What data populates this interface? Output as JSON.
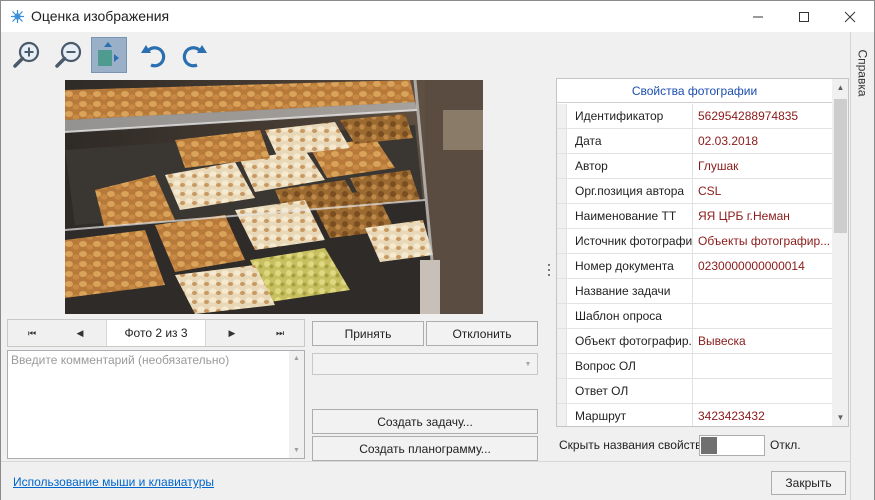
{
  "window": {
    "title": "Оценка изображения",
    "side_tab": "Справка"
  },
  "toolbar": {
    "icons": [
      "zoom-in-icon",
      "zoom-out-icon",
      "fit-image-icon",
      "rotate-left-icon",
      "rotate-right-icon"
    ],
    "active": "fit-image-icon"
  },
  "navigator": {
    "label": "Фото 2 из 3"
  },
  "comment": {
    "placeholder": "Введите комментарий (необязательно)"
  },
  "actions": {
    "accept": "Принять",
    "reject": "Отклонить",
    "create_task": "Создать задачу...",
    "create_planogram": "Создать планограмму..."
  },
  "properties": {
    "header": "Свойства фотографии",
    "rows": [
      {
        "key": "Идентификатор",
        "value": "562954288974835"
      },
      {
        "key": "Дата",
        "value": "02.03.2018"
      },
      {
        "key": "Автор",
        "value": "Глушак"
      },
      {
        "key": "Орг.позиция автора",
        "value": "CSL"
      },
      {
        "key": "Наименование ТТ",
        "value": "ЯЯ ЦРБ г.Неман"
      },
      {
        "key": "Источник фотографии",
        "value": "Объекты фотографир..."
      },
      {
        "key": "Номер документа",
        "value": "0230000000000014"
      },
      {
        "key": "Название задачи",
        "value": ""
      },
      {
        "key": "Шаблон опроса",
        "value": ""
      },
      {
        "key": "Объект фотографир...",
        "value": "Вывеска"
      },
      {
        "key": "Вопрос ОЛ",
        "value": ""
      },
      {
        "key": "Ответ ОЛ",
        "value": ""
      },
      {
        "key": "Маршрут",
        "value": "3423423432"
      }
    ]
  },
  "hide_names": {
    "label": "Скрыть названия свойств:",
    "state": "Откл."
  },
  "footer": {
    "help_link": "Использование мыши и клавиатуры",
    "close": "Закрыть"
  },
  "colors": {
    "accent_blue": "#1c4eae",
    "value_red": "#8b1a1a",
    "link": "#0066cc",
    "active_tool": "#99b0c8"
  }
}
